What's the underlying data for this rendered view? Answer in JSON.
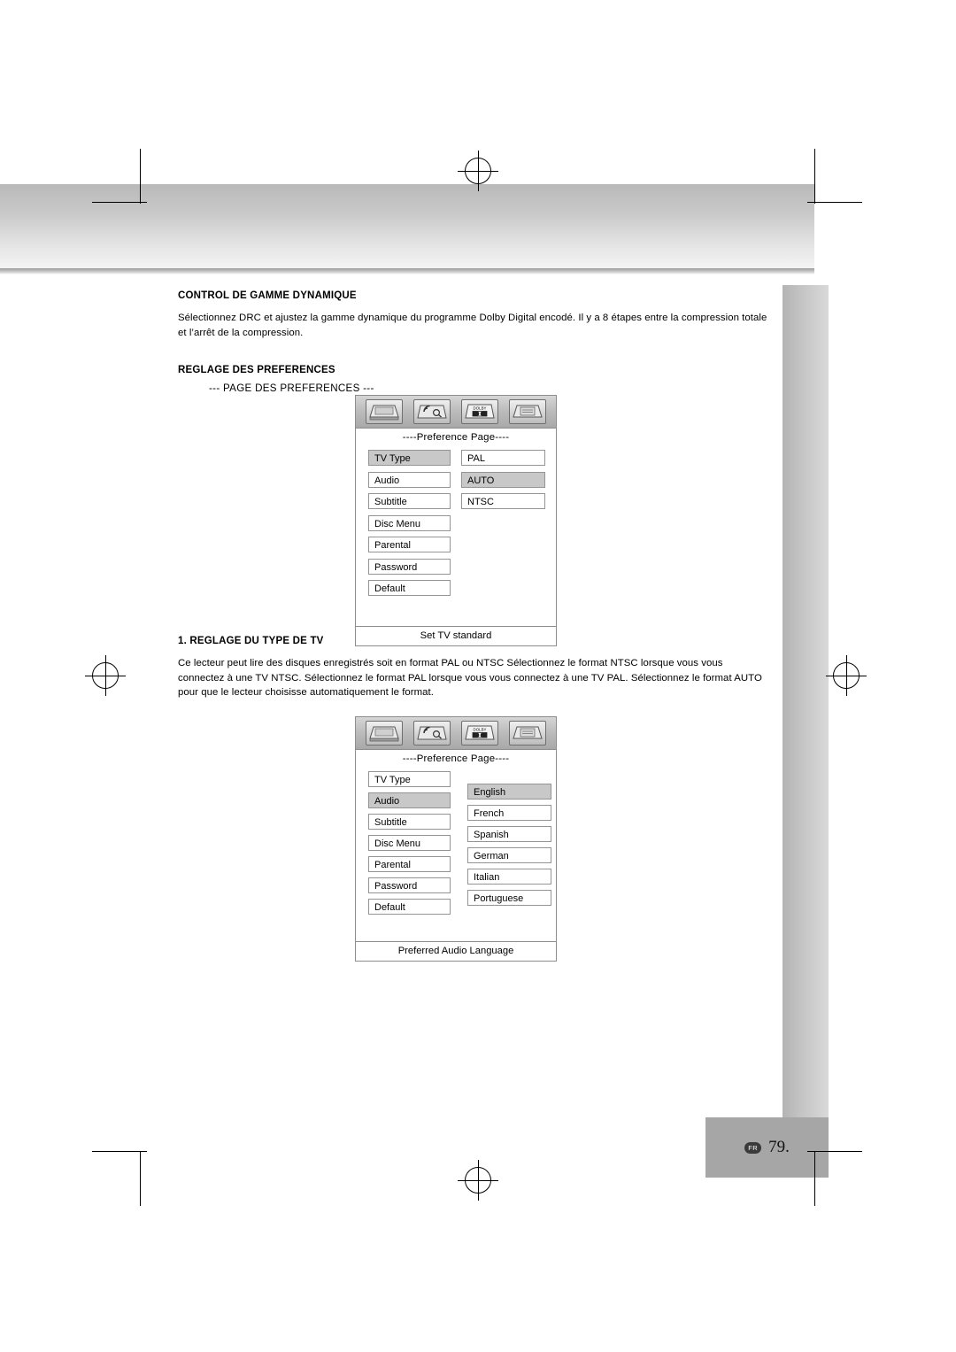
{
  "page": {
    "number": "79.",
    "locale_badge": "FR"
  },
  "sections": [
    {
      "title": "CONTROL DE GAMME DYNAMIQUE",
      "text": "Sélectionnez DRC et ajustez la gamme dynamique du programme Dolby Digital encodé. Il y a 8 étapes entre la compression totale et l’arrêt de la compression."
    },
    {
      "title": "REGLAGE DES PREFERENCES",
      "caption": "--- PAGE DES PREFERENCES ---"
    },
    {
      "title": "1. REGLAGE DU TYPE DE TV",
      "text": "Ce lecteur peut lire des disques enregistrés soit en format PAL ou NTSC Sélectionnez le format NTSC lorsque vous vous connectez à une TV NTSC. Sélectionnez le format PAL lorsque vous vous connectez à une TV PAL. Sélectionnez le format AUTO pour que le lecteur choisisse automatiquement le format."
    }
  ],
  "osd_first": {
    "title": "----Preference Page----",
    "footer": "Set TV standard",
    "icons": [
      "tv-screen-icon",
      "audio-waves-icon",
      "dolby-digital-icon",
      "display-setup-icon"
    ],
    "dolby_label": "DOLBY",
    "left_menu": [
      {
        "label": "TV Type",
        "selected": true
      },
      {
        "label": "Audio",
        "selected": false
      },
      {
        "label": "Subtitle",
        "selected": false
      },
      {
        "label": "Disc Menu",
        "selected": false
      },
      {
        "label": "Parental",
        "selected": false
      },
      {
        "label": "Password",
        "selected": false
      },
      {
        "label": "Default",
        "selected": false
      }
    ],
    "right_menu": [
      {
        "label": "PAL",
        "selected": false
      },
      {
        "label": "AUTO",
        "selected": true
      },
      {
        "label": "NTSC",
        "selected": false
      }
    ]
  },
  "osd_second": {
    "title": "----Preference Page----",
    "footer": "Preferred Audio Language",
    "icons": [
      "tv-screen-icon",
      "audio-waves-icon",
      "dolby-digital-icon",
      "display-setup-icon"
    ],
    "dolby_label": "DOLBY",
    "left_menu": [
      {
        "label": "TV Type",
        "selected": false
      },
      {
        "label": "Audio",
        "selected": true
      },
      {
        "label": "Subtitle",
        "selected": false
      },
      {
        "label": "Disc Menu",
        "selected": false
      },
      {
        "label": "Parental",
        "selected": false
      },
      {
        "label": "Password",
        "selected": false
      },
      {
        "label": "Default",
        "selected": false
      }
    ],
    "right_menu": [
      {
        "label": "English",
        "selected": true
      },
      {
        "label": "French",
        "selected": false
      },
      {
        "label": "Spanish",
        "selected": false
      },
      {
        "label": "German",
        "selected": false
      },
      {
        "label": "Italian",
        "selected": false
      },
      {
        "label": "Portuguese",
        "selected": false
      }
    ]
  }
}
